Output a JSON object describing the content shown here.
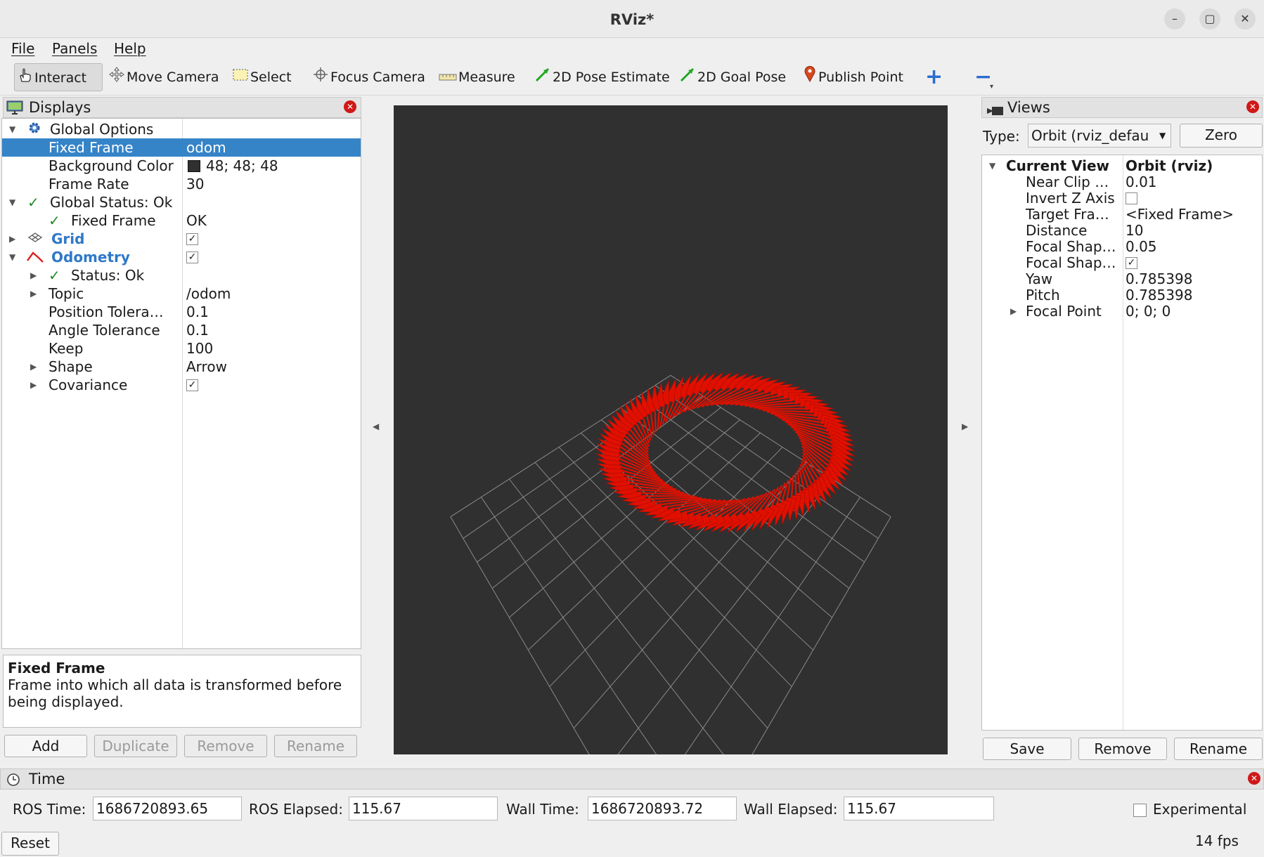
{
  "window": {
    "title": "RViz*"
  },
  "menu": {
    "file": "File",
    "panels": "Panels",
    "help": "Help"
  },
  "toolbar": {
    "interact": "Interact",
    "move_camera": "Move Camera",
    "select": "Select",
    "focus_camera": "Focus Camera",
    "measure": "Measure",
    "pose_estimate": "2D Pose Estimate",
    "goal_pose": "2D Goal Pose",
    "publish_point": "Publish Point",
    "add_tool": "+",
    "remove_tool": "−"
  },
  "displays": {
    "title": "Displays",
    "global_options": "Global Options",
    "fixed_frame_label": "Fixed Frame",
    "fixed_frame_value": "odom",
    "bg_color_label": "Background Color",
    "bg_color_value": "48; 48; 48",
    "bg_color_swatch": "#303030",
    "frame_rate_label": "Frame Rate",
    "frame_rate_value": "30",
    "global_status": "Global Status: Ok",
    "status_fixed_frame_label": "Fixed Frame",
    "status_fixed_frame_value": "OK",
    "grid": "Grid",
    "odometry": "Odometry",
    "status_ok": "Status: Ok",
    "topic_label": "Topic",
    "topic_value": "/odom",
    "pos_tol_label": "Position Tolera…",
    "pos_tol_value": "0.1",
    "ang_tol_label": "Angle Tolerance",
    "ang_tol_value": "0.1",
    "keep_label": "Keep",
    "keep_value": "100",
    "shape_label": "Shape",
    "shape_value": "Arrow",
    "covariance_label": "Covariance",
    "check_mark": "✓",
    "desc_title": "Fixed Frame",
    "desc_text": "Frame into which all data is transformed before being displayed.",
    "add": "Add",
    "duplicate": "Duplicate",
    "remove": "Remove",
    "rename": "Rename"
  },
  "views": {
    "title": "Views",
    "type_label": "Type:",
    "type_value": "Orbit (rviz_defau",
    "zero": "Zero",
    "current_view": "Current View",
    "current_view_value": "Orbit (rviz)",
    "near_clip_label": "Near Clip …",
    "near_clip_value": "0.01",
    "invert_z_label": "Invert Z Axis",
    "target_frame_label": "Target Fra…",
    "target_frame_value": "<Fixed Frame>",
    "distance_label": "Distance",
    "distance_value": "10",
    "focal_shape1_label": "Focal Shap…",
    "focal_shape1_value": "0.05",
    "focal_shape2_label": "Focal Shap…",
    "yaw_label": "Yaw",
    "yaw_value": "0.785398",
    "pitch_label": "Pitch",
    "pitch_value": "0.785398",
    "focal_point_label": "Focal Point",
    "focal_point_value": "0; 0; 0",
    "save": "Save",
    "remove": "Remove",
    "rename": "Rename"
  },
  "time": {
    "title": "Time",
    "ros_time_label": "ROS Time:",
    "ros_time_value": "1686720893.65",
    "ros_elapsed_label": "ROS Elapsed:",
    "ros_elapsed_value": "115.67",
    "wall_time_label": "Wall Time:",
    "wall_time_value": "1686720893.72",
    "wall_elapsed_label": "Wall Elapsed:",
    "wall_elapsed_value": "115.67",
    "experimental": "Experimental",
    "reset": "Reset",
    "fps": "14 fps"
  },
  "colors": {
    "viewport_bg": "#303030",
    "arrow": "#e01000",
    "selection": "#3584c8"
  }
}
